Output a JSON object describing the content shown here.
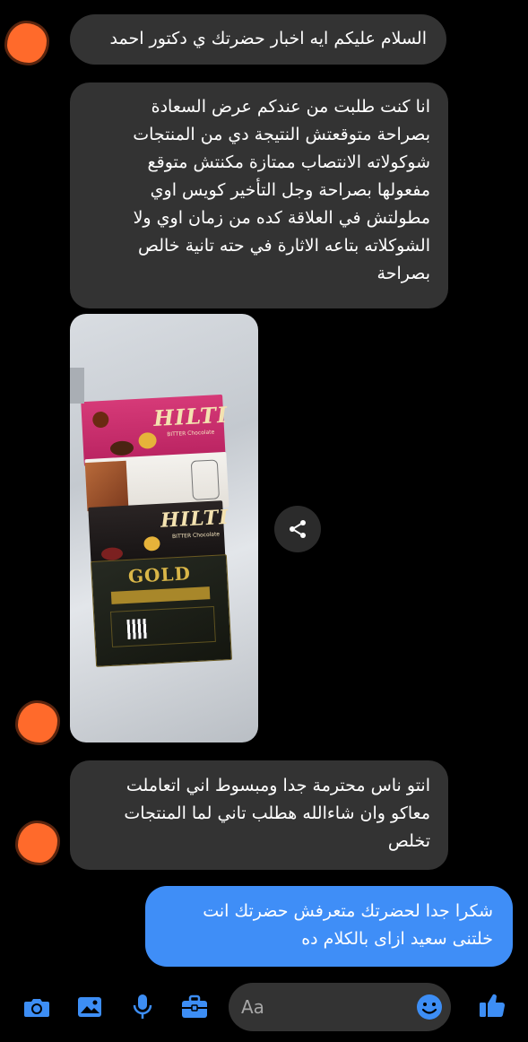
{
  "messages": [
    {
      "text": "السلام عليكم ايه اخبار حضرتك ي دكتور احمد"
    },
    {
      "lines": [
        "انا كنت طلبت من عندكم عرض السعادة",
        "بصراحة متوقعتش النتيجة دي من المنتجات",
        "شوكولاته الانتصاب ممتازة مكنتش متوقع",
        "مفعولها بصراحة وجل التأخير كويس اوي",
        "مطولتش في العلاقة كده من زمان اوي ولا",
        "الشوكلاته بتاعه الاثارة في حته تانية خالص",
        "بصراحة"
      ]
    },
    {
      "lines": [
        "انتو ناس محترمة جدا ومبسوط اني اتعاملت",
        "معاكو وان شاءالله هطلب تاني لما المنتجات",
        "تخلص"
      ]
    },
    {
      "lines": [
        "شكرا جدا لحضرتك متعرفش حضرتك انت",
        "خلتنى سعيد ازاى بالكلام ده"
      ]
    }
  ],
  "photo": {
    "box1": {
      "brand": "HILTI",
      "sub": "BITTER Chocolate"
    },
    "box3": {
      "brand": "HILTI",
      "sub": "BITTER Chocolate"
    },
    "box4": {
      "brand": "GOLD"
    }
  },
  "composer": {
    "placeholder": "Aa"
  },
  "colors": {
    "incoming": "#333333",
    "outgoing": "#3f8ef7",
    "accent": "#3d8ef5",
    "avatar": "#ff6a2b"
  },
  "icons": [
    "camera-icon",
    "image-icon",
    "microphone-icon",
    "briefcase-icon",
    "emoji-icon",
    "thumbs-up-icon",
    "share-icon"
  ]
}
